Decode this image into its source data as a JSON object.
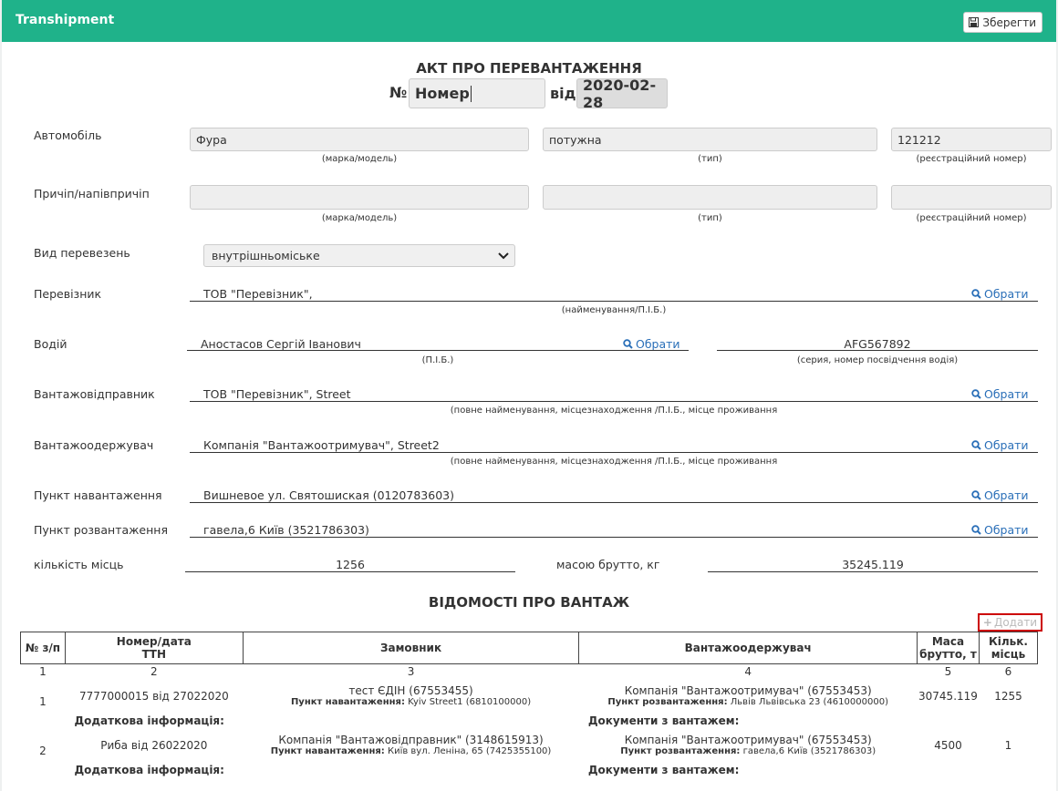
{
  "app": {
    "title": "Transhipment",
    "save_label": "Зберегти"
  },
  "act": {
    "title": "АКТ ПРО ПЕРЕВАНТАЖЕННЯ",
    "number_prefix": "№",
    "number_value": "Номер",
    "date_prefix": "від",
    "date_value": "2020-02-28"
  },
  "hints": {
    "make_model": "(марка/модель)",
    "type": "(тип)",
    "reg_number": "(реєстраційний номер)",
    "name": "(найменування/П.І.Б.)",
    "pib": "(П.І.Б.)",
    "license": "(серия, номер посвідчення водія)",
    "full_name": "(повне найменування, місцезнаходження /П.І.Б., місце проживання"
  },
  "vehicle": {
    "label": "Автомобіль",
    "make": "Фура",
    "type": "потужна",
    "reg": "121212"
  },
  "trailer": {
    "label": "Причіп/напівпричіп",
    "make": "",
    "type": "",
    "reg": ""
  },
  "transport_kind": {
    "label": "Вид перевезень",
    "value": "внутрішньоміське"
  },
  "pick_label": "Обрати",
  "carrier": {
    "label": "Перевізник",
    "value": "ТОВ \"Перевізник\","
  },
  "driver": {
    "label": "Водій",
    "value": "Аностасов Сергій Іванович",
    "license": "AFG567892"
  },
  "shipper": {
    "label": "Вантажовідправник",
    "value": "ТОВ \"Перевізник\", Street"
  },
  "consignee": {
    "label": "Вантажоодержувач",
    "value": "Компанія \"Вантажоотримувач\", Street2"
  },
  "loading_point": {
    "label": "Пункт навантаження",
    "value": "Вишневое ул. Святошиская (0120783603)"
  },
  "unloading_point": {
    "label": "Пункт розвантаження",
    "value": "гавела,6 Київ (3521786303)"
  },
  "places": {
    "label": "кількість місць",
    "value": "1256"
  },
  "gross": {
    "label": "масою брутто, кг",
    "value": "35245.119"
  },
  "cargo": {
    "title": "ВІДОМОСТІ ПРО ВАНТАЖ",
    "add_label": "Додати",
    "headers": {
      "no": "№ з/п",
      "ttn_1": "Номер/дата",
      "ttn_2": "ТТН",
      "customer": "Замовник",
      "consignee": "Вантажоодержувач",
      "mass_1": "Маса",
      "mass_2": "брутто, т",
      "qty_1": "Кільк.",
      "qty_2": "місць"
    },
    "col_numbers": [
      "1",
      "2",
      "3",
      "4",
      "5",
      "6"
    ],
    "extra_label": "Додаткова інформація:",
    "docs_label": "Документи з вантажем:",
    "loading_label": "Пункт навантаження:",
    "unloading_label": "Пункт розвантаження:",
    "rows": [
      {
        "no": "1",
        "ttn": "7777000015 від 27022020",
        "customer": "тест ЄДІН (67553455)",
        "loading": "Kyiv Street1 (6810100000)",
        "consignee": "Компанія \"Вантажоотримувач\" (67553453)",
        "unloading": "Львів Львівська 23 (4610000000)",
        "mass": "30745.119",
        "qty": "1255"
      },
      {
        "no": "2",
        "ttn": "Риба від 26022020",
        "customer": "Компанія \"Вантажовідправник\" (3148615913)",
        "loading": "Київ вул. Леніна, 65 (7425355100)",
        "consignee": "Компанія \"Вантажоотримувач\" (67553453)",
        "unloading": "гавела,6 Київ (3521786303)",
        "mass": "4500",
        "qty": "1"
      }
    ]
  },
  "colors": {
    "header": "#1fb28a",
    "link": "#2a6fb8",
    "add_border": "#cc0000"
  }
}
